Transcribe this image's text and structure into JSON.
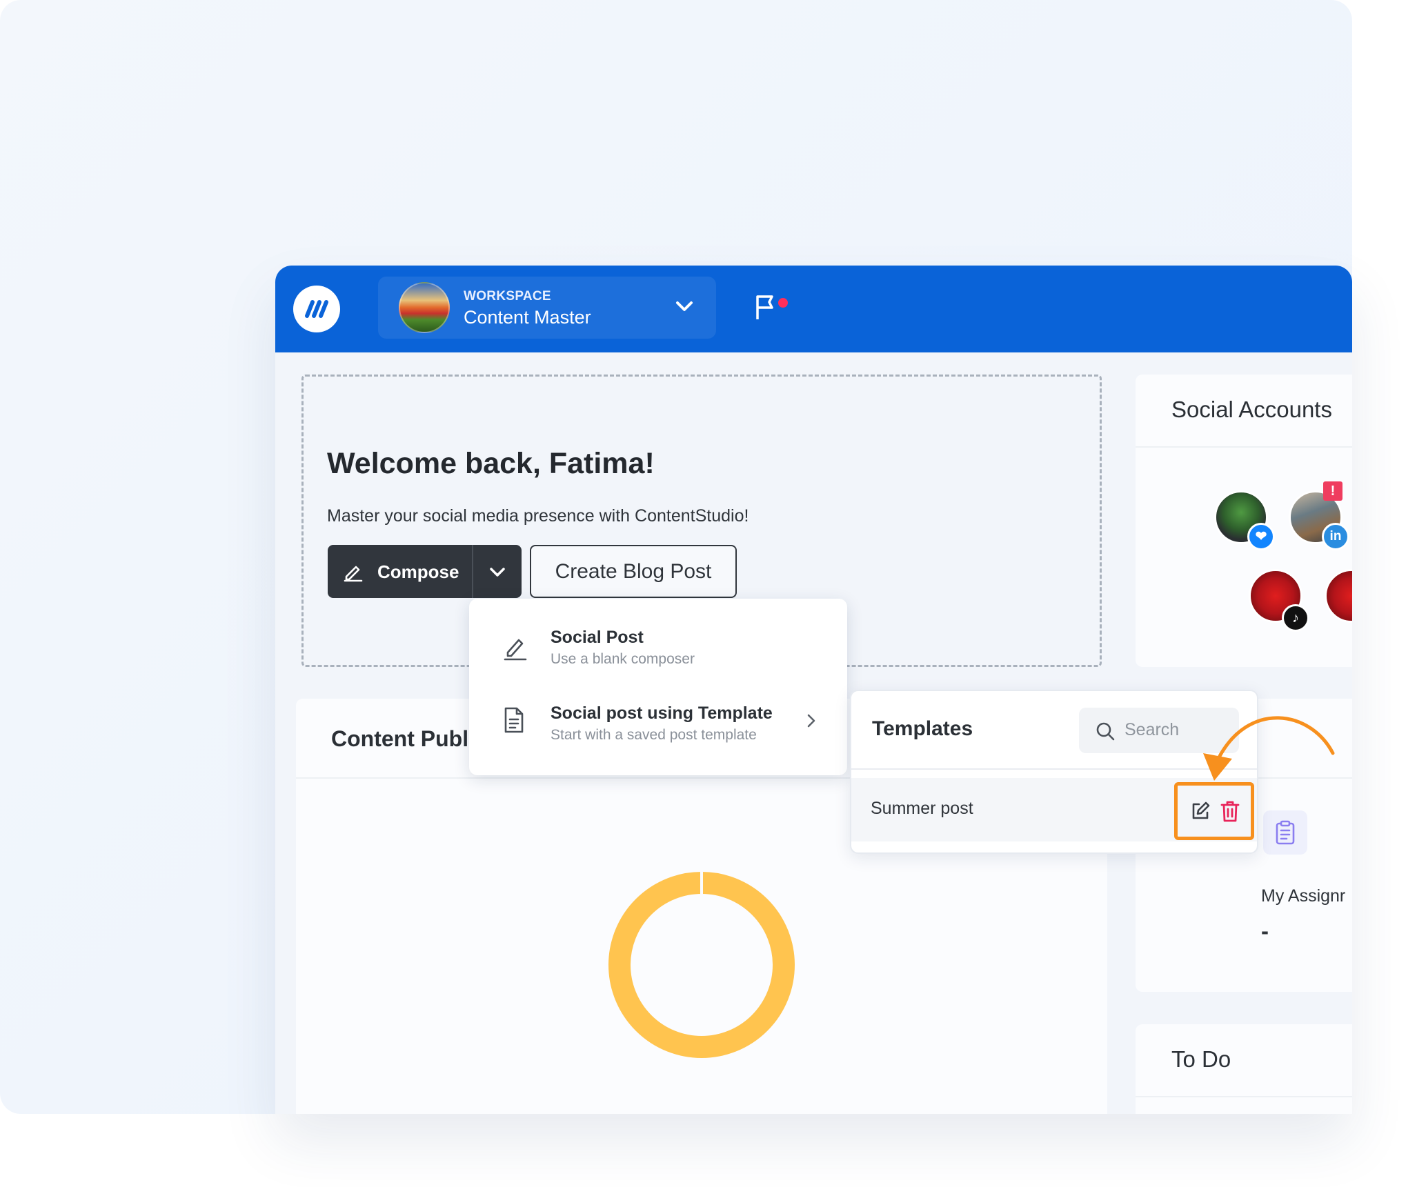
{
  "topbar": {
    "workspace_label": "WORKSPACE",
    "workspace_name": "Content Master"
  },
  "welcome": {
    "heading": "Welcome back, Fatima!",
    "subtext": "Master your social media presence with ContentStudio!",
    "compose_label": "Compose",
    "blog_label": "Create Blog Post"
  },
  "compose_menu": {
    "items": [
      {
        "title": "Social Post",
        "subtitle": "Use a blank composer"
      },
      {
        "title": "Social post using Template",
        "subtitle": "Start with a saved post template"
      }
    ]
  },
  "templates": {
    "title": "Templates",
    "search_placeholder": "Search",
    "rows": [
      {
        "name": "Summer post"
      }
    ]
  },
  "content_card": {
    "title": "Content Publi"
  },
  "social_accounts": {
    "title": "Social Accounts",
    "alert_badge": "!"
  },
  "assignments": {
    "label": "My Assignr",
    "value": "-"
  },
  "todo": {
    "title": "To Do"
  },
  "colors": {
    "topbar": "#0a63d8",
    "highlight": "#f7901e",
    "donut": "#ffc44f",
    "delete": "#e8245a"
  }
}
